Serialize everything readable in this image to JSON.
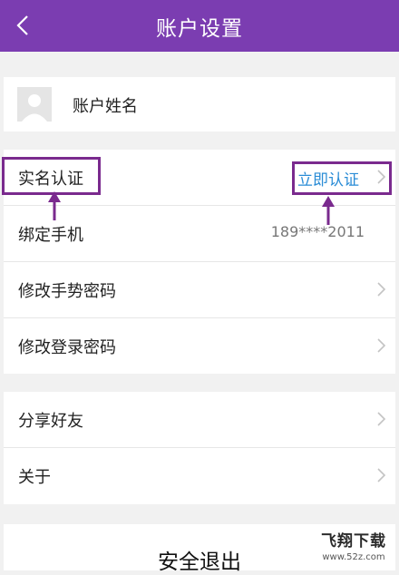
{
  "header": {
    "title": "账户设置",
    "background": "#7b3db1"
  },
  "profile": {
    "name": "账户姓名"
  },
  "settings": {
    "realname": {
      "label": "实名认证",
      "action": "立即认证"
    },
    "bind_phone": {
      "label": "绑定手机",
      "value": "189****2011"
    },
    "gesture_password": {
      "label": "修改手势密码"
    },
    "login_password": {
      "label": "修改登录密码"
    }
  },
  "more": {
    "share": {
      "label": "分享好友"
    },
    "about": {
      "label": "关于"
    }
  },
  "logout": {
    "label": "安全退出"
  },
  "watermark": {
    "main": "飞翔下载",
    "sub": "www.52z.com"
  },
  "colors": {
    "accent": "#7b3db1",
    "link": "#2a8cd6",
    "highlight": "#7a2a8e"
  }
}
